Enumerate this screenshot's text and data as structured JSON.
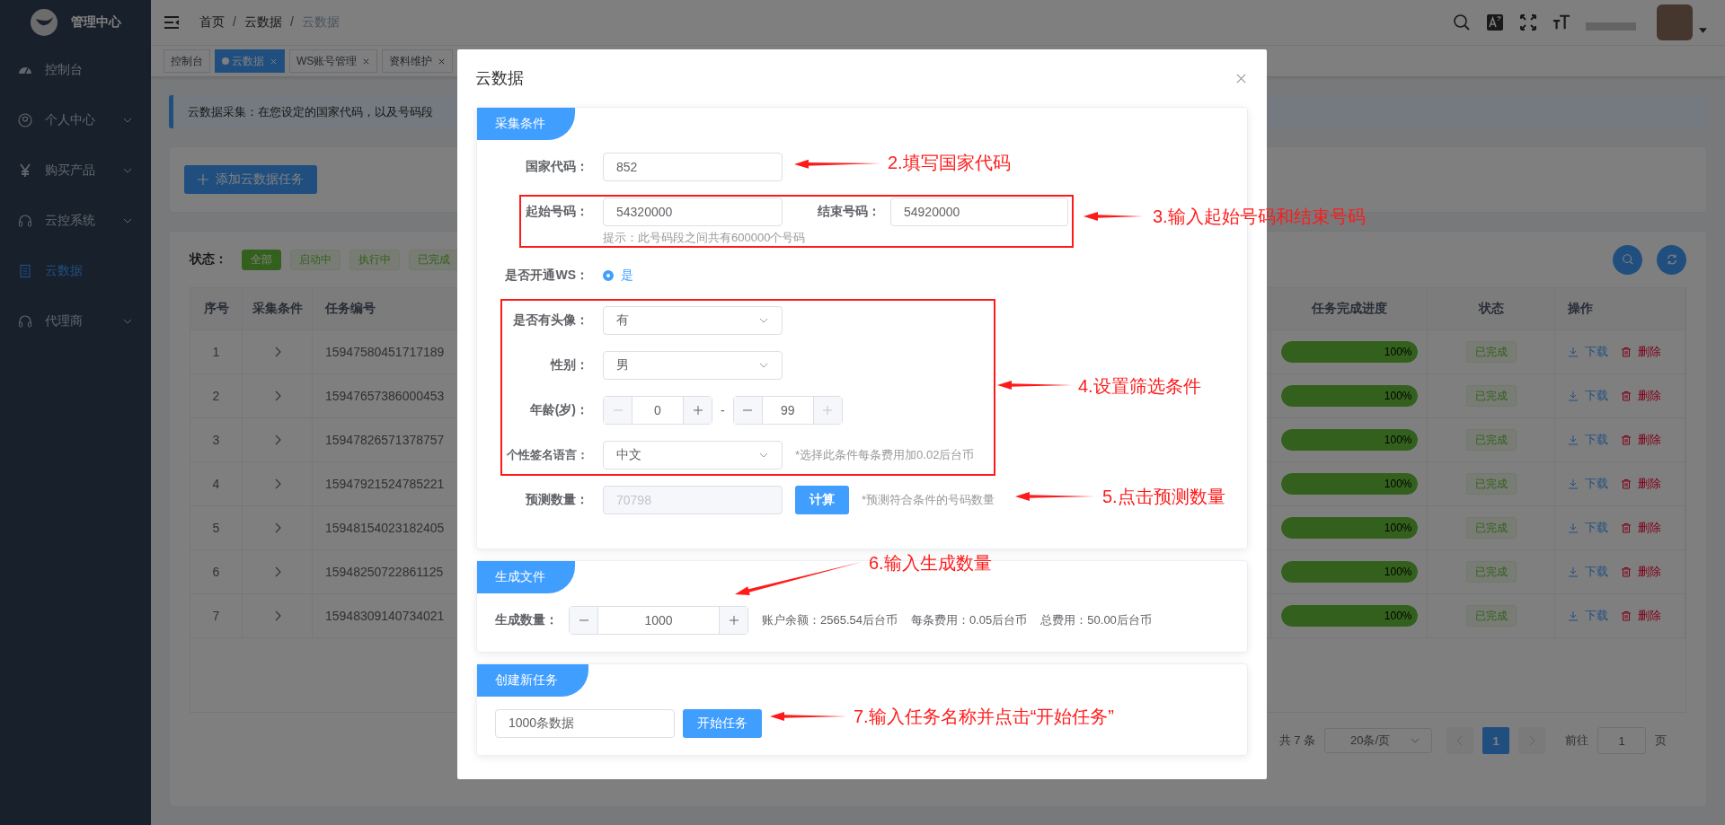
{
  "sidebar": {
    "title": "管理中心",
    "items": [
      {
        "label": "控制台",
        "selected": false,
        "expandable": false
      },
      {
        "label": "个人中心",
        "selected": false,
        "expandable": true
      },
      {
        "label": "购买产品",
        "selected": false,
        "expandable": true
      },
      {
        "label": "云控系统",
        "selected": false,
        "expandable": true
      },
      {
        "label": "云数据",
        "selected": true,
        "expandable": false
      },
      {
        "label": "代理商",
        "selected": false,
        "expandable": true
      }
    ]
  },
  "header": {
    "breadcrumb": [
      "首页",
      "云数据",
      "云数据"
    ],
    "separator": "/"
  },
  "tabs": [
    {
      "label": "控制台",
      "selected": false,
      "closable": false
    },
    {
      "label": "云数据",
      "selected": true,
      "closable": true
    },
    {
      "label": "WS账号管理",
      "selected": false,
      "closable": true
    },
    {
      "label": "资料维护",
      "selected": false,
      "closable": true
    }
  ],
  "alert": "云数据采集：在您设定的国家代码，以及号码段",
  "add_button": "添加云数据任务",
  "status_filter": {
    "label": "状态：",
    "options": [
      {
        "label": "全部",
        "selected": true
      },
      {
        "label": "启动中",
        "selected": false
      },
      {
        "label": "执行中",
        "selected": false
      },
      {
        "label": "已完成",
        "selected": false
      }
    ]
  },
  "table": {
    "columns": [
      "序号",
      "采集条件",
      "任务编号",
      "任务完成进度",
      "状态",
      "操作"
    ],
    "rows": [
      {
        "index": "1",
        "task_id": "15947580451717189",
        "level": 1,
        "progress": "100%",
        "status": "已完成",
        "download": "下载",
        "delete": "删除"
      },
      {
        "index": "2",
        "task_id": "15947657386000453",
        "level": 1,
        "progress": "100%",
        "status": "已完成",
        "download": "下载",
        "delete": "删除"
      },
      {
        "index": "3",
        "task_id": "15947826571378757",
        "level": 1,
        "progress": "100%",
        "status": "已完成",
        "download": "下载",
        "delete": "删除"
      },
      {
        "index": "4",
        "task_id": "15947921524785221",
        "level": 1,
        "progress": "100%",
        "status": "已完成",
        "download": "下载",
        "delete": "删除"
      },
      {
        "index": "5",
        "task_id": "15948154023182405",
        "level": 1,
        "progress": "100%",
        "status": "已完成",
        "download": "下载",
        "delete": "删除"
      },
      {
        "index": "6",
        "task_id": "15948250722861125",
        "level": 1,
        "progress": "100%",
        "status": "已完成",
        "download": "下载",
        "delete": "删除"
      },
      {
        "index": "7",
        "task_id": "15948309140734021",
        "level": 1,
        "progress": "100%",
        "status": "已完成",
        "download": "下载",
        "delete": "删除"
      }
    ]
  },
  "pagination": {
    "total": "共 7 条",
    "page_size": "20条/页",
    "pages": [
      {
        "label": "1",
        "selected": true
      }
    ],
    "goto_label": "前往",
    "goto_value": "1",
    "goto_suffix": "页"
  },
  "dialog": {
    "title": "云数据",
    "criteria": {
      "title": "采集条件",
      "country_code": {
        "label": "国家代码：",
        "value": "852"
      },
      "start_number": {
        "label": "起始号码：",
        "value": "54320000"
      },
      "end_number": {
        "label": "结束号码：",
        "value": "54920000"
      },
      "range_hint": "提示：此号码段之间共有600000个号码",
      "ws": {
        "label": "是否开通WS：",
        "options": [
          {
            "label": "是",
            "selected": true
          }
        ]
      },
      "avatar": {
        "label": "是否有头像：",
        "value": "有"
      },
      "gender": {
        "label": "性别：",
        "value": "男"
      },
      "age": {
        "label": "年龄(岁)：",
        "separator": "-",
        "min": {
          "value": "0",
          "decrease_disabled": true,
          "increase_disabled": false
        },
        "max": {
          "value": "99",
          "decrease_disabled": false,
          "increase_disabled": true
        }
      },
      "signature_language": {
        "label": "个性签名语言：",
        "value": "中文",
        "note": "*选择此条件每条费用加0.02后台币"
      },
      "forecast": {
        "label": "预测数量：",
        "value": "70798",
        "disabled": true,
        "button": "计算",
        "note": "*预测符合条件的号码数量"
      }
    },
    "generate": {
      "title": "生成文件",
      "quantity": {
        "label": "生成数量：",
        "value": "1000"
      },
      "balance": "账户余额：2565.54后台币",
      "unit_cost": "每条费用：0.05后台币",
      "total_cost": "总费用：50.00后台币"
    },
    "create": {
      "title": "创建新任务",
      "task_name": "1000条数据",
      "button": "开始任务"
    }
  },
  "annotations": [
    {
      "text": "2.填写国家代码"
    },
    {
      "text": "3.输入起始号码和结束号码"
    },
    {
      "text": "4.设置筛选条件"
    },
    {
      "text": "5.点击预测数量"
    },
    {
      "text": "6.输入生成数量"
    },
    {
      "text": "7.输入任务名称并点击“开始任务”"
    }
  ]
}
